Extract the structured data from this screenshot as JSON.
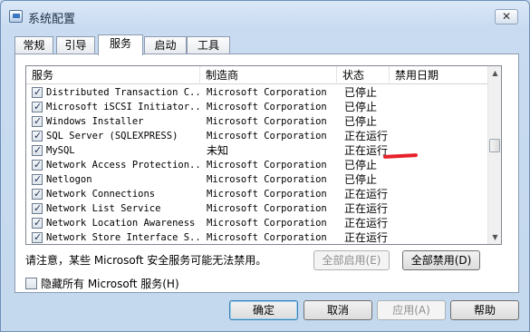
{
  "window": {
    "title": "系统配置",
    "close_glyph": "✕"
  },
  "tabs": [
    {
      "label": "常规",
      "active": false
    },
    {
      "label": "引导",
      "active": false
    },
    {
      "label": "服务",
      "active": true
    },
    {
      "label": "启动",
      "active": false
    },
    {
      "label": "工具",
      "active": false
    }
  ],
  "list": {
    "columns": [
      "服务",
      "制造商",
      "状态",
      "禁用日期"
    ],
    "rows": [
      {
        "name": "Distributed Transaction C...",
        "manufacturer": "Microsoft Corporation",
        "status": "已停止",
        "checked": true
      },
      {
        "name": "Microsoft iSCSI Initiator...",
        "manufacturer": "Microsoft Corporation",
        "status": "已停止",
        "checked": true
      },
      {
        "name": "Windows Installer",
        "manufacturer": "Microsoft Corporation",
        "status": "已停止",
        "checked": true
      },
      {
        "name": "SQL Server (SQLEXPRESS)",
        "manufacturer": "Microsoft Corporation",
        "status": "正在运行",
        "checked": true
      },
      {
        "name": "MySQL",
        "manufacturer": "未知",
        "status": "正在运行",
        "checked": true
      },
      {
        "name": "Network Access Protection...",
        "manufacturer": "Microsoft Corporation",
        "status": "已停止",
        "checked": true
      },
      {
        "name": "Netlogon",
        "manufacturer": "Microsoft Corporation",
        "status": "已停止",
        "checked": true
      },
      {
        "name": "Network Connections",
        "manufacturer": "Microsoft Corporation",
        "status": "正在运行",
        "checked": true
      },
      {
        "name": "Network List Service",
        "manufacturer": "Microsoft Corporation",
        "status": "正在运行",
        "checked": true
      },
      {
        "name": "Network Location Awareness",
        "manufacturer": "Microsoft Corporation",
        "status": "正在运行",
        "checked": true
      },
      {
        "name": "Network Store Interface S...",
        "manufacturer": "Microsoft Corporation",
        "status": "正在运行",
        "checked": true
      }
    ]
  },
  "note": "请注意，某些 Microsoft 安全服务可能无法禁用。",
  "buttons": {
    "enable_all": "全部启用(E)",
    "disable_all": "全部禁用(D)",
    "ok": "确定",
    "cancel": "取消",
    "apply": "应用(A)",
    "help": "帮助"
  },
  "hide_ms": {
    "label": "隐藏所有 Microsoft 服务(H)",
    "checked": false
  },
  "colors": {
    "annotation_mark": "#e8202a"
  }
}
